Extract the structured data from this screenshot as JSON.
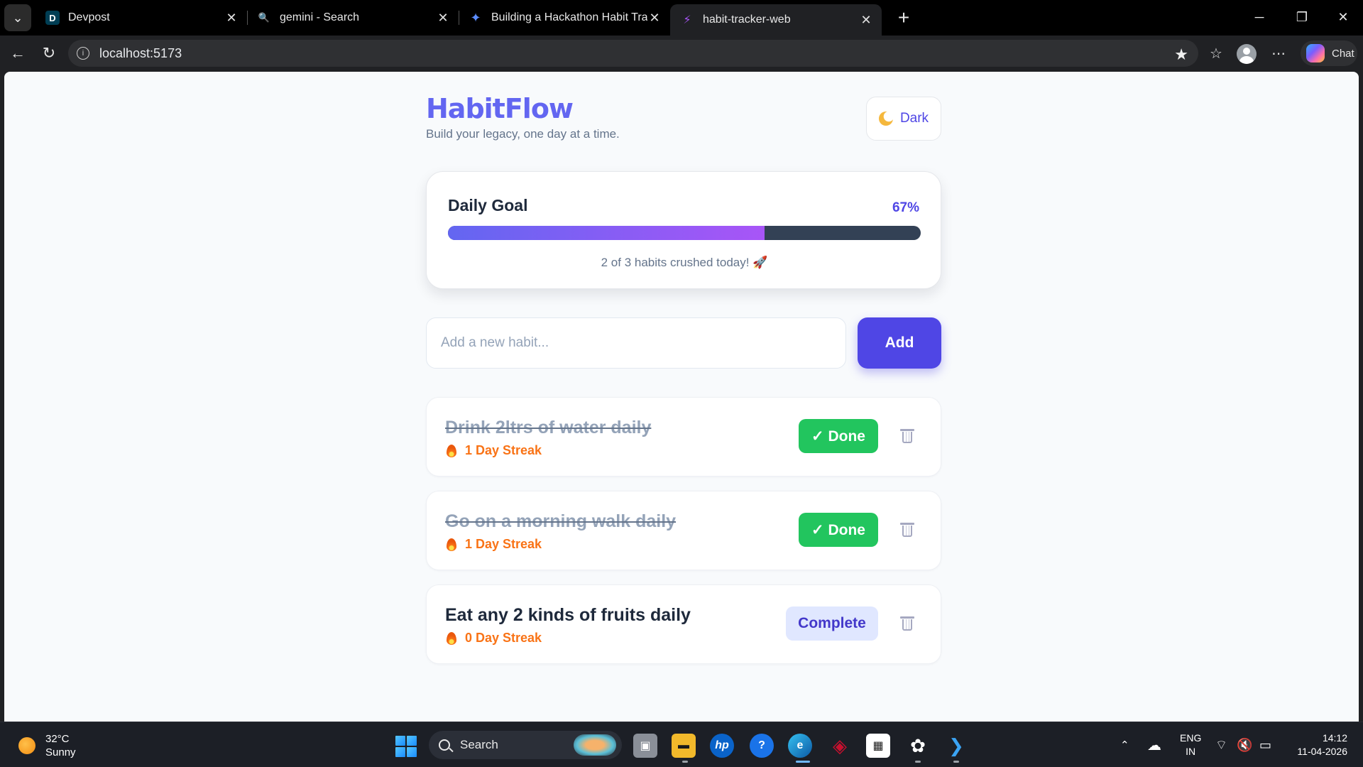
{
  "browser": {
    "tabs": [
      {
        "title": "Devpost",
        "favicon": "D",
        "icon": "devpost-icon",
        "active": false
      },
      {
        "title": "gemini - Search",
        "favicon": "🔍",
        "icon": "search-icon",
        "active": false
      },
      {
        "title": "Building a Hackathon Habit Tracker",
        "favicon": "✦",
        "icon": "gemini-icon",
        "active": false
      },
      {
        "title": "habit-tracker-web",
        "favicon": "⚡",
        "icon": "vite-icon",
        "active": true
      }
    ],
    "url": "localhost:5173",
    "chat_label": "Chat"
  },
  "app": {
    "brand": "HabitFlow",
    "tagline": "Build your legacy, one day at a time.",
    "theme_toggle_label": "Dark",
    "accent_color": "#6366f1",
    "daily_goal": {
      "title": "Daily Goal",
      "percent_label": "67%",
      "progress": 0.67,
      "summary": "2 of 3 habits crushed today! 🚀"
    },
    "new_habit": {
      "placeholder": "Add a new habit...",
      "value": "",
      "add_label": "Add"
    },
    "habits": [
      {
        "name": "Drink 2ltrs of water daily",
        "streak": "1 Day Streak",
        "done": true,
        "action_label": "✓ Done"
      },
      {
        "name": "Go on a morning walk daily",
        "streak": "1 Day Streak",
        "done": true,
        "action_label": "✓ Done"
      },
      {
        "name": "Eat any 2 kinds of fruits daily",
        "streak": "0 Day Streak",
        "done": false,
        "action_label": "Complete"
      }
    ]
  },
  "taskbar": {
    "weather_temp": "32°C",
    "weather_desc": "Sunny",
    "search_label": "Search",
    "lang_top": "ENG",
    "lang_bottom": "IN",
    "time": "14:12",
    "date": "11-04-2026"
  }
}
